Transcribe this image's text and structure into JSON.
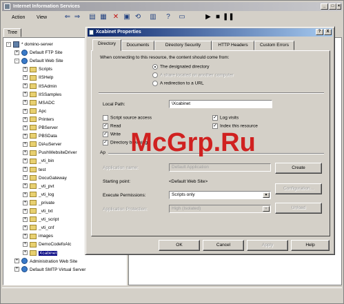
{
  "window": {
    "title": "Internet Information Services",
    "menu": [
      "Action",
      "View"
    ]
  },
  "tree": {
    "tab_label": "Tree",
    "items": [
      {
        "label": "* domino-server",
        "level": 0,
        "icon": "server-icon",
        "expander": "-"
      },
      {
        "label": "Default FTP Site",
        "level": 1,
        "icon": "globe-icon",
        "expander": "+"
      },
      {
        "label": "Default Web Site",
        "level": 1,
        "icon": "globe-icon",
        "expander": "-"
      },
      {
        "label": "Scripts",
        "level": 2,
        "icon": "folder-icon",
        "expander": "+"
      },
      {
        "label": "IISHelp",
        "level": 2,
        "icon": "folder-icon",
        "expander": "+"
      },
      {
        "label": "IISAdmin",
        "level": 2,
        "icon": "folder-icon",
        "expander": "+"
      },
      {
        "label": "IISSamples",
        "level": 2,
        "icon": "folder-icon",
        "expander": "+"
      },
      {
        "label": "MSADC",
        "level": 2,
        "icon": "folder-icon",
        "expander": "+"
      },
      {
        "label": "Apc",
        "level": 2,
        "icon": "folder-icon",
        "expander": "+"
      },
      {
        "label": "Printers",
        "level": 2,
        "icon": "folder-icon",
        "expander": "+"
      },
      {
        "label": "PBServer",
        "level": 2,
        "icon": "folder-icon",
        "expander": "+"
      },
      {
        "label": "PBSData",
        "level": 2,
        "icon": "folder-icon",
        "expander": "+"
      },
      {
        "label": "DiAuServer",
        "level": 2,
        "icon": "folder-icon",
        "expander": "+"
      },
      {
        "label": "PushWebsiteDriver",
        "level": 2,
        "icon": "folder-icon",
        "expander": "+"
      },
      {
        "label": "_vti_bin",
        "level": 2,
        "icon": "folder-icon",
        "expander": "+"
      },
      {
        "label": "test",
        "level": 2,
        "icon": "folder-icon",
        "expander": "+"
      },
      {
        "label": "DocuGateway",
        "level": 2,
        "icon": "folder-icon",
        "expander": "+"
      },
      {
        "label": "_vti_pvt",
        "level": 2,
        "icon": "folder-icon",
        "expander": "+"
      },
      {
        "label": "_vti_log",
        "level": 2,
        "icon": "folder-icon",
        "expander": "+"
      },
      {
        "label": "_private",
        "level": 2,
        "icon": "folder-icon",
        "expander": "+"
      },
      {
        "label": "_vti_txt",
        "level": 2,
        "icon": "folder-icon",
        "expander": "+"
      },
      {
        "label": "_vti_script",
        "level": 2,
        "icon": "folder-icon",
        "expander": "+"
      },
      {
        "label": "_vti_cnf",
        "level": 2,
        "icon": "folder-icon",
        "expander": "+"
      },
      {
        "label": "images",
        "level": 2,
        "icon": "folder-icon",
        "expander": "+"
      },
      {
        "label": "DemoCodefoAlc",
        "level": 2,
        "icon": "folder-icon",
        "expander": "+"
      },
      {
        "label": "Xcabinet",
        "level": 2,
        "icon": "folder-icon",
        "expander": "+",
        "selected": true
      },
      {
        "label": "Administration Web Site",
        "level": 1,
        "icon": "globe-icon",
        "expander": "+"
      },
      {
        "label": "Default SMTP Virtual Server",
        "level": 1,
        "icon": "globe-icon",
        "expander": "+"
      }
    ]
  },
  "dialog": {
    "title": "Xcabinet Properties",
    "tabs": [
      "Directory",
      "Documents",
      "Directory Security",
      "HTTP Headers",
      "Custom Errors"
    ],
    "active_tab": "Directory",
    "intro": "When connecting to this resource, the content should come from:",
    "source_options": [
      {
        "label": "The designated directory",
        "selected": true,
        "enabled": true
      },
      {
        "label": "A share located on another computer",
        "selected": false,
        "enabled": false
      },
      {
        "label": "A redirection to a URL",
        "selected": false,
        "enabled": true
      }
    ],
    "local_path_label": "Local Path:",
    "local_path_value": "\\Xcabinet",
    "permissions_left": [
      {
        "label": "Script source access",
        "checked": false
      },
      {
        "label": "Read",
        "checked": true
      },
      {
        "label": "Write",
        "checked": true
      },
      {
        "label": "Directory browsing",
        "checked": true
      }
    ],
    "permissions_right": [
      {
        "label": "Log visits",
        "checked": true
      },
      {
        "label": "Index this resource",
        "checked": true
      }
    ],
    "app_settings_label": "Ap",
    "app_name_label": "Application name:",
    "app_name_value": "Default Application",
    "starting_point_label": "Starting point:",
    "starting_point_value": "<Default Web Site>",
    "exec_perm_label": "Execute Permissions:",
    "exec_perm_value": "Scripts only",
    "app_protection_label": "Application Protection:",
    "app_protection_value": "High (Isolated)",
    "side_buttons": [
      {
        "label": "Create",
        "enabled": true
      },
      {
        "label": "Configuration...",
        "enabled": false
      },
      {
        "label": "Unload",
        "enabled": false
      }
    ],
    "buttons": [
      {
        "label": "OK",
        "enabled": true
      },
      {
        "label": "Cancel",
        "enabled": true
      },
      {
        "label": "Apply",
        "enabled": false
      },
      {
        "label": "Help",
        "enabled": true
      }
    ],
    "title_buttons": [
      "?",
      "X"
    ]
  },
  "watermark": "McGrp.Ru"
}
